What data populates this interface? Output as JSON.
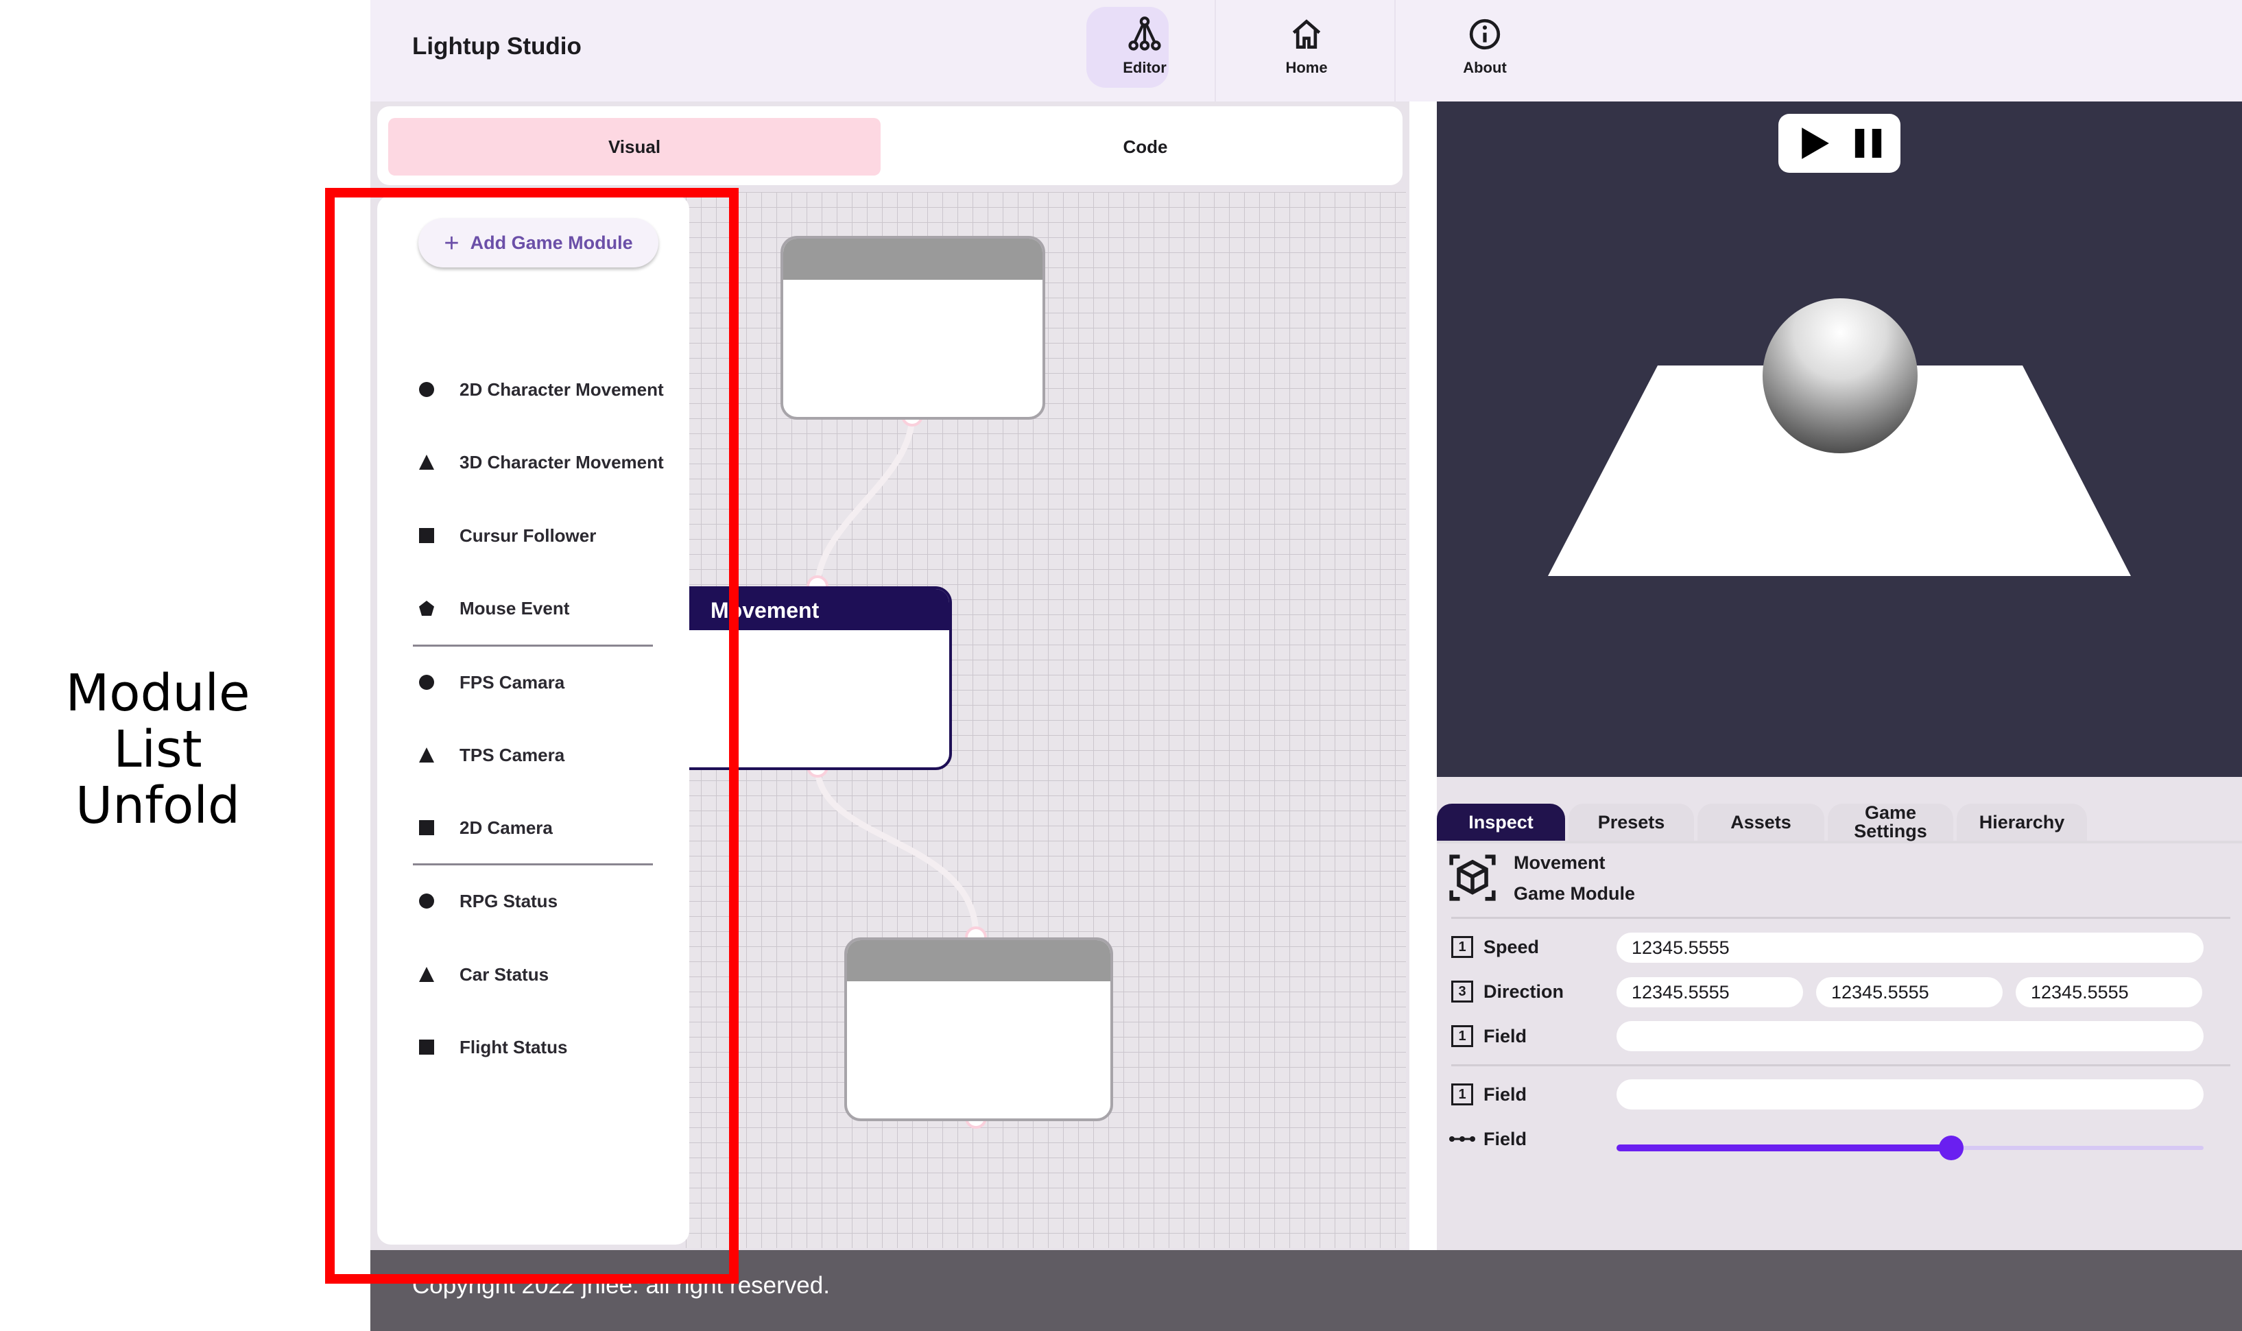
{
  "annotation": {
    "line1": "Module List",
    "line2": "Unfold"
  },
  "app": {
    "title": "Lightup Studio"
  },
  "nav": [
    {
      "label": "Editor",
      "icon": "editor-tree-icon"
    },
    {
      "label": "Home",
      "icon": "home-icon"
    },
    {
      "label": "About",
      "icon": "info-icon"
    }
  ],
  "editor_tabs": {
    "visual": "Visual",
    "code": "Code"
  },
  "module_list": {
    "add_button": "Add Game Module",
    "items": [
      {
        "label": "2D Character Movement",
        "shape": "circle"
      },
      {
        "label": "3D Character Movement",
        "shape": "triangle"
      },
      {
        "label": "Cursur Follower",
        "shape": "square"
      },
      {
        "label": "Mouse Event",
        "shape": "pentagon"
      },
      {
        "label": "FPS Camara",
        "shape": "circle"
      },
      {
        "label": "TPS Camera",
        "shape": "triangle"
      },
      {
        "label": "2D Camera",
        "shape": "square"
      },
      {
        "label": "RPG Status",
        "shape": "circle"
      },
      {
        "label": "Car Status",
        "shape": "triangle"
      },
      {
        "label": "Flight Status",
        "shape": "square"
      }
    ]
  },
  "nodes": {
    "movement_title": "Movement"
  },
  "viewport": {
    "controls": [
      "play-icon",
      "pause-icon"
    ]
  },
  "inspector": {
    "tabs": [
      "Inspect",
      "Presets",
      "Assets",
      "Game Settings",
      "Hierarchy"
    ],
    "header": {
      "name": "Movement",
      "type": "Game Module",
      "icon": "cube-icon"
    },
    "fields": [
      {
        "icon_text": "1",
        "label": "Speed",
        "values": [
          "12345.5555"
        ]
      },
      {
        "icon_text": "3",
        "label": "Direction",
        "values": [
          "12345.5555",
          "12345.5555",
          "12345.5555"
        ]
      },
      {
        "icon_text": "1",
        "label": "Field",
        "values": [
          ""
        ]
      },
      {
        "icon_text": "1",
        "label": "Field",
        "values": [
          ""
        ]
      },
      {
        "icon_text": "",
        "label": "Field",
        "slider": 0.57
      }
    ]
  },
  "footer": {
    "text": "Copyright 2022 jhlee. all right reserved."
  },
  "colors": {
    "accent": "#6a1ff0",
    "dark_navy": "#1e0f56",
    "visual_tab": "#fdd8e2",
    "highlight": "#ff0000"
  }
}
